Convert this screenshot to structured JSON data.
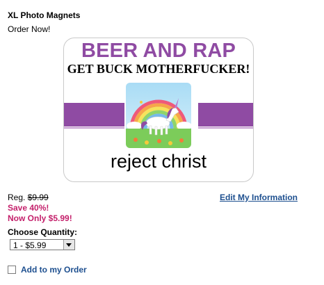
{
  "product": {
    "title": "XL Photo Magnets",
    "subtitle": "Order Now!"
  },
  "magnet": {
    "headline": "BEER AND RAP",
    "subheadline": "GET BUCK MOTHERFUCKER!",
    "caption": "reject christ",
    "accent_color": "#8f4ba3",
    "image": "unicorn-rainbow-image"
  },
  "pricing": {
    "reg_prefix": "Reg.",
    "reg_price": "$9.99",
    "save": "Save 40%!",
    "now_only": "Now Only $5.99!",
    "sale_color": "#c4206b"
  },
  "links": {
    "edit_info": "Edit My Information"
  },
  "quantity": {
    "label": "Choose Quantity:",
    "selected": "1 - $5.99"
  },
  "order": {
    "add_label": "Add to my Order",
    "checked": false
  }
}
